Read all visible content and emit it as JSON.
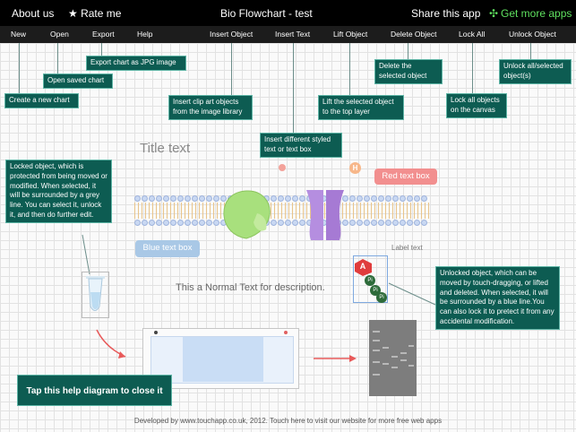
{
  "topbar": {
    "about": "About us",
    "rate": "★ Rate me",
    "title": "Bio Flowchart - test",
    "share": "Share this app",
    "more": "Get more apps"
  },
  "toolbar": {
    "new": "New",
    "open": "Open",
    "export": "Export",
    "help": "Help",
    "insert_object": "Insert Object",
    "insert_text": "Insert Text",
    "lift_object": "Lift Object",
    "delete_object": "Delete Object",
    "lock_all": "Lock All",
    "unlock_object": "Unlock Object"
  },
  "tips": {
    "export": "Export chart as JPG image",
    "open": "Open saved chart",
    "new": "Create a new chart",
    "insert_object": "Insert clip art objects from the image library",
    "insert_text": "Insert different styled text or text box",
    "lift": "Lift the selected object to the top layer",
    "delete": "Delete the selected object",
    "lock": "Lock all objects on the canvas",
    "unlock": "Unlock all/selected object(s)",
    "locked": "Locked object, which is protected from being moved or modified. When selected, it will be surrounded by a grey line. You can select it, unlock it, and then do further edit.",
    "unlocked": "Unlocked object, which can be moved by touch-dragging, or lifted and deleted. When selected, it will be surrounded by a blue line.You can also lock it to pretect it from any accidental modification.",
    "close": "Tap this help diagram to close it"
  },
  "canvas": {
    "title_text": "Title text",
    "red_text_box": "Red text box",
    "blue_text_box": "Blue text box",
    "label_text": "Label text",
    "normal_text": "This a Normal Text for description.",
    "atp_a": "A",
    "pi": "Pi",
    "h_marker": "H"
  },
  "footer": "Developed by www.touchapp.co.uk, 2012. Touch here to visit our website for more free web apps",
  "colors": {
    "tip_bg": "#0d5c52",
    "red_box": "#f28f8f",
    "blue_box": "#a9c8e6",
    "more_icon": "#3cc43c"
  }
}
